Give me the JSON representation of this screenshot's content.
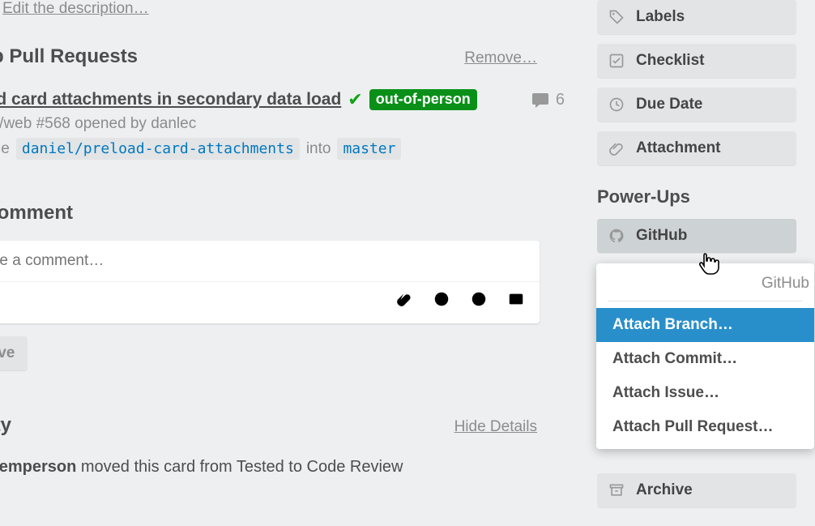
{
  "edit_description_link": "Edit the description…",
  "pull_requests": {
    "heading": "Hub Pull Requests",
    "remove_link": "Remove…",
    "item": {
      "title": "Load card attachments in secondary data load",
      "status_badge": "out-of-person",
      "comment_count": "6",
      "repo": "trello/web",
      "number": "#568",
      "opened_by_prefix": "opened by",
      "opened_by": "danlec",
      "merge_word": "merge",
      "source_branch": "daniel/preload-card-attachments",
      "into_word": "into",
      "target_branch": "master"
    }
  },
  "comment": {
    "heading": "d Comment",
    "placeholder": "Write a comment…",
    "save_label": "Save"
  },
  "activity": {
    "heading": "tivity",
    "hide_details": "Hide Details",
    "entry_actor": "ris Temperson",
    "entry_rest": " moved this card from Tested to Code Review"
  },
  "sidebar": {
    "labels": "Labels",
    "checklist": "Checklist",
    "due_date": "Due Date",
    "attachment": "Attachment",
    "powerups_heading": "Power-Ups",
    "github": "GitHub",
    "archive": "Archive"
  },
  "popover": {
    "title": "GitHub",
    "items": [
      "Attach Branch…",
      "Attach Commit…",
      "Attach Issue…",
      "Attach Pull Request…"
    ]
  }
}
